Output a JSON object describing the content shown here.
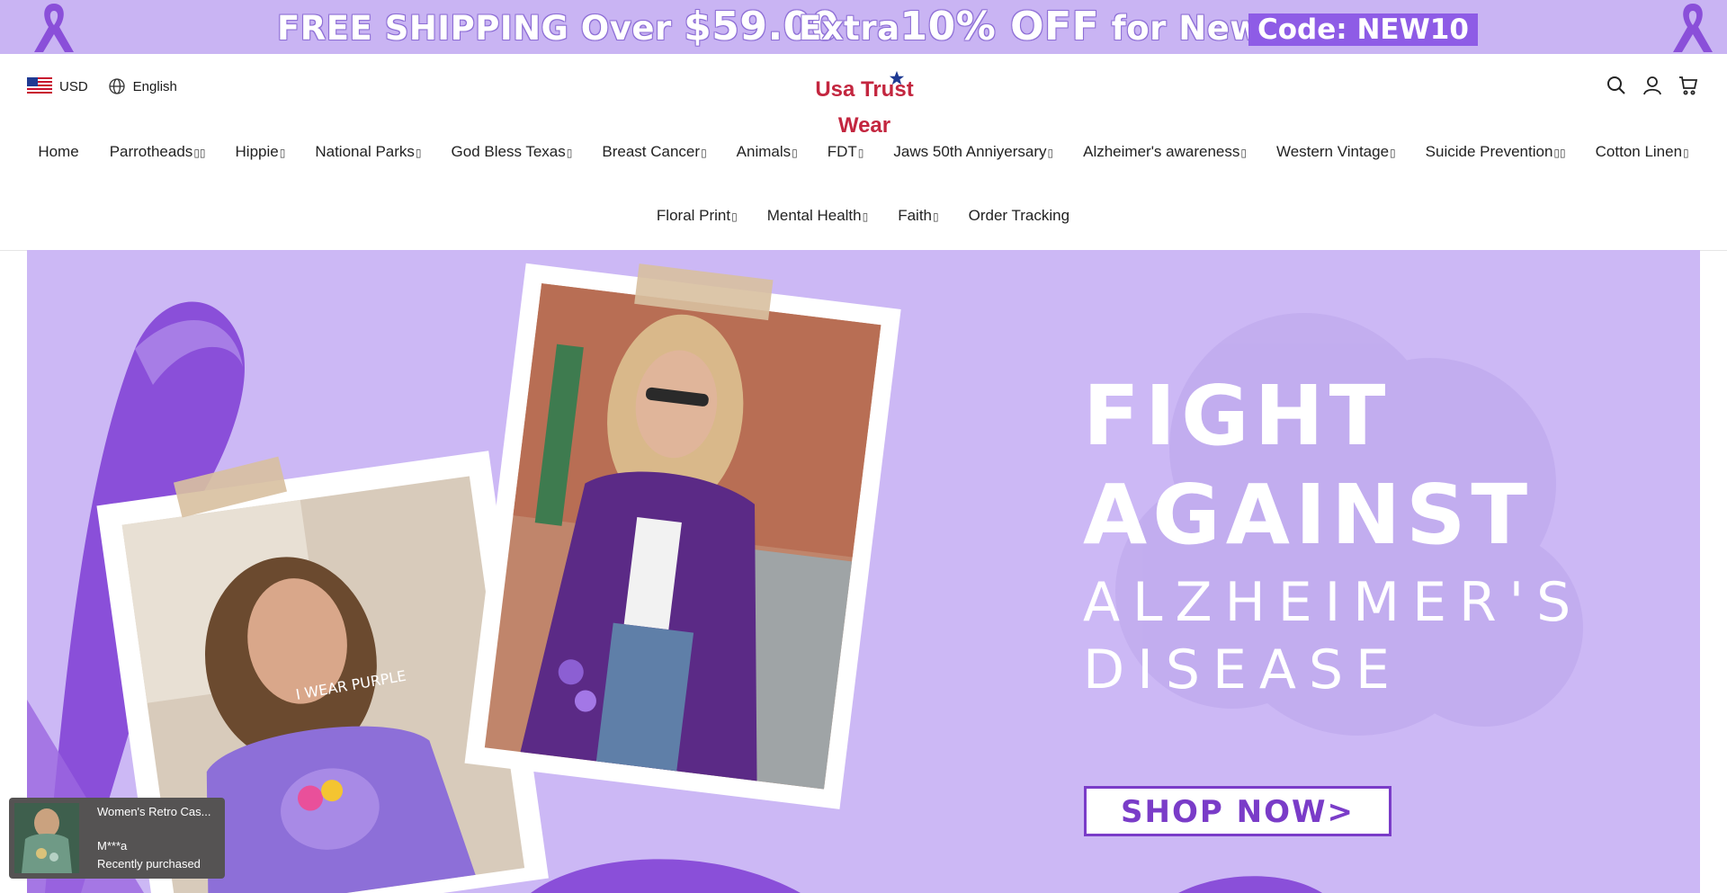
{
  "promo": {
    "shipping_text": "FREE SHIPPING Over",
    "shipping_amount": "$59.00",
    "discount_prefix": "Extra",
    "discount_pct": "10% OFF",
    "discount_suffix": "for New User",
    "code": "Code: NEW10",
    "colors": {
      "bar": "#c9b4f3",
      "code_bg": "#8e5ce6"
    }
  },
  "header": {
    "currency": "USD",
    "language": "English",
    "logo": "Usa Trust Wear",
    "icons": [
      "search-icon",
      "account-icon",
      "cart-icon"
    ]
  },
  "nav": {
    "row1": [
      {
        "label": "Home",
        "caret": ""
      },
      {
        "label": "Parrotheads",
        "caret": "▯▯"
      },
      {
        "label": "Hippie",
        "caret": "▯"
      },
      {
        "label": "National Parks",
        "caret": "▯"
      },
      {
        "label": "God Bless Texas",
        "caret": "▯"
      },
      {
        "label": "Breast Cancer",
        "caret": "▯"
      },
      {
        "label": "Animals",
        "caret": "▯"
      },
      {
        "label": "FDT",
        "caret": "▯"
      },
      {
        "label": "Jaws 50th Anniyersary",
        "caret": "▯"
      },
      {
        "label": "Alzheimer's awareness",
        "caret": "▯"
      },
      {
        "label": "Western Vintage",
        "caret": "▯"
      },
      {
        "label": "Suicide Prevention",
        "caret": "▯▯"
      },
      {
        "label": "Cotton Linen",
        "caret": "▯"
      }
    ],
    "row2": [
      {
        "label": "Floral Print",
        "caret": "▯"
      },
      {
        "label": "Mental Health",
        "caret": "▯"
      },
      {
        "label": "Faith",
        "caret": "▯"
      },
      {
        "label": "Order Tracking",
        "caret": ""
      }
    ]
  },
  "hero": {
    "title_line1": "FIGHT",
    "title_line2": "AGAINST",
    "sub_line1": "ALZHEIMER'S",
    "sub_line2": "DISEASE",
    "shirt_text": "I WEAR PURPLE",
    "button": "SHOP NOW>",
    "colors": {
      "bg": "#ccb8f5",
      "accent": "#7a3cc8"
    }
  },
  "toast": {
    "product": "Women's Retro Cas...",
    "buyer": "M***a",
    "status": "Recently purchased"
  }
}
